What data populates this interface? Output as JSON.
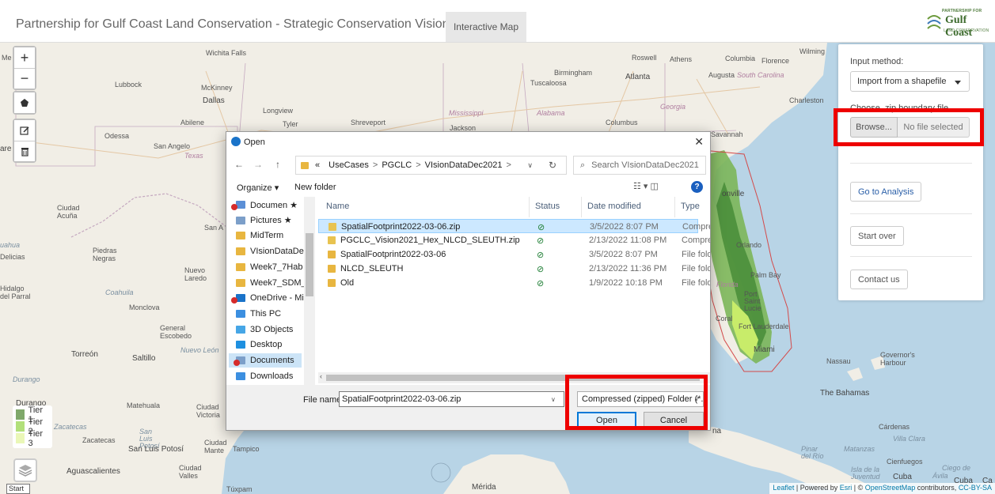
{
  "header": {
    "title": "Partnership for Gulf Coast Land Conservation - Strategic Conservation Vision Tool",
    "tab_label": "Interactive Map",
    "logo_line1": "PARTNERSHIP FOR",
    "logo_line2": "Gulf Coast",
    "logo_line3": "LAND CONSERVATION"
  },
  "map": {
    "cities": {
      "wichita_falls": "Wichita Falls",
      "lubbock": "Lubbock",
      "mckinney": "McKinney",
      "dallas": "Dallas",
      "abilene": "Abilene",
      "longview": "Longview",
      "tyler": "Tyler",
      "shreveport": "Shreveport",
      "jackson": "Jackson",
      "odessa": "Odessa",
      "san_angelo": "San Angelo",
      "texas": "Texas",
      "mississippi": "Mississippi",
      "alabama": "Alabama",
      "georgia": "Georgia",
      "south_carolina": "South Carolina",
      "roswell": "Roswell",
      "athens": "Athens",
      "birmingham": "Birmingham",
      "atlanta": "Atlanta",
      "tuscaloosa": "Tuscaloosa",
      "columbia": "Columbia",
      "florence": "Florence",
      "augusta": "Augusta",
      "charleston": "Charleston",
      "columbus": "Columbus",
      "savannah": "Savannah",
      "wilmington": "Wilming",
      "ciudad_acuna": "Ciudad Acuña",
      "san": "San A",
      "delicias": "Delicias",
      "piedras_negras": "Piedras Negras",
      "nuevo_laredo": "Nuevo Laredo",
      "coahuila": "Coahuila",
      "hidalgo": "Hidalgo del Parral",
      "monclova": "Monclova",
      "general_escobedo": "General Escobedo",
      "nuevo_leon": "Nuevo León",
      "torreon": "Torreón",
      "saltillo": "Saltillo",
      "durango": "Durango",
      "durango2": "Durango",
      "matehuala": "Matehuala",
      "ciudad_victoria": "Ciudad Victoria",
      "zacatecas": "Zacatecas",
      "zacatecas2": "Zacatecas",
      "san_luis": "San Luis Potosí",
      "san_luis_potosi": "San Luis Potosí",
      "ciudad_mante": "Ciudad Mante",
      "tampico": "Tampico",
      "aguascalientes": "Aguascalientes",
      "ciudad_valles": "Ciudad Valles",
      "tuxpam": "Túxpam",
      "merida": "Mérida",
      "nassau": "Nassau",
      "governors_harbour": "Governor's Harbour",
      "the_bahamas": "The Bahamas",
      "cardenas": "Cárdenas",
      "villa_clara": "Villa Clara",
      "pinar_del_rio": "Pinar del Río",
      "matanzas": "Matanzas",
      "isla_de_la_juventud": "Isla de la Juventud",
      "cienfuegos": "Cienfuegos",
      "ciego": "Ciego de",
      "cuba": "Cuba",
      "cuba2": "Cuba",
      "avila": "Ávila",
      "orlando": "Orlando",
      "palm_bay": "Palm Bay",
      "port_saint_lucie": "Port Saint Lucie",
      "fort_lauderdale": "Fort Lauderdale",
      "miami": "Miami",
      "coral": "Coral",
      "orville": "onville",
      "na": "na",
      "florida": "Florida",
      "ca": "Ca",
      "are": "are",
      "me": "Me",
      "uahua": "uahua"
    },
    "controls": {
      "zoom_in": "+",
      "zoom_out": "−"
    },
    "legend": [
      {
        "label": "Tier 1",
        "color": "#7fa86a"
      },
      {
        "label": "Tier 2",
        "color": "#b2e07a"
      },
      {
        "label": "Tier 3",
        "color": "#eaf7b7"
      }
    ],
    "start_label": "Start",
    "attribution": {
      "leaflet": "Leaflet",
      "powered": " | Powered by ",
      "esri": "Esri",
      "osm_pre": " | © ",
      "osm": "OpenStreetMap",
      "contrib": " contributors, ",
      "cc": "CC-BY-SA"
    }
  },
  "panel": {
    "input_method_label": "Input method:",
    "input_method_value": "Import from a shapefile",
    "choose_label": "Choose .zip boundary file",
    "browse_label": "Browse...",
    "no_file_label": "No file selected",
    "go_analysis": "Go to Analysis",
    "start_over": "Start over",
    "contact_us": "Contact us"
  },
  "dialog": {
    "title": "Open",
    "close": "✕",
    "nav": {
      "back": "←",
      "forward": "→",
      "up": "↑"
    },
    "breadcrumb": [
      "«",
      "UseCases",
      "PGCLC",
      "VIsionDataDec2021"
    ],
    "breadcrumb_sep": ">",
    "search_placeholder": "Search VIsionDataDec2021",
    "organize": "Organize ▾",
    "new_folder": "New folder",
    "view_icons": "☷ ▾   ◫",
    "help": "?",
    "nav_pane": [
      {
        "label": "Documen ★",
        "icon": "#5b8fd6",
        "badge": true
      },
      {
        "label": "Pictures  ★",
        "icon": "#7c9fc9"
      },
      {
        "label": "MidTerm",
        "icon": "#e8b640"
      },
      {
        "label": "VIsionDataDe",
        "icon": "#e8b640"
      },
      {
        "label": "Week7_7Hab",
        "icon": "#e8b640"
      },
      {
        "label": "Week7_SDM_",
        "icon": "#e8b640"
      },
      {
        "label": "OneDrive - Mis",
        "icon": "#1a73c9",
        "badge": true
      },
      {
        "label": "This PC",
        "icon": "#3c8fe0"
      },
      {
        "label": "3D Objects",
        "icon": "#46a6e6"
      },
      {
        "label": "Desktop",
        "icon": "#1e90e0"
      },
      {
        "label": "Documents",
        "icon": "#7c9fc9",
        "badge": true,
        "selected": true
      },
      {
        "label": "Downloads",
        "icon": "#3c8fe0"
      }
    ],
    "columns": {
      "name": "Name",
      "status": "Status",
      "date": "Date modified",
      "type": "Type"
    },
    "files": [
      {
        "name": "SpatialFootprint2022-03-06.zip",
        "status": "⊘",
        "date": "3/5/2022 8:07 PM",
        "type": "Compres",
        "icon": "#e8c350",
        "selected": true
      },
      {
        "name": "PGCLC_Vision2021_Hex_NLCD_SLEUTH.zip",
        "status": "⊘",
        "date": "2/13/2022 11:08 PM",
        "type": "Compres",
        "icon": "#e8c350"
      },
      {
        "name": "SpatialFootprint2022-03-06",
        "status": "⊘",
        "date": "3/5/2022 8:07 PM",
        "type": "File folde",
        "icon": "#e8b640"
      },
      {
        "name": "NLCD_SLEUTH",
        "status": "⊘",
        "date": "2/13/2022 11:36 PM",
        "type": "File folde",
        "icon": "#e8b640"
      },
      {
        "name": "Old",
        "status": "⊘",
        "date": "1/9/2022 10:18 PM",
        "type": "File folde",
        "icon": "#e8b640"
      }
    ],
    "file_name_label": "File name:",
    "file_name_value": "SpatialFootprint2022-03-06.zip",
    "file_type_value": "Compressed (zipped) Folder (*.",
    "open_label": "Open",
    "cancel_label": "Cancel"
  },
  "colors": {
    "highlight": "#ee0000",
    "accent": "#0078d7",
    "land": "#f2efe6",
    "water": "#b7d4e8"
  }
}
